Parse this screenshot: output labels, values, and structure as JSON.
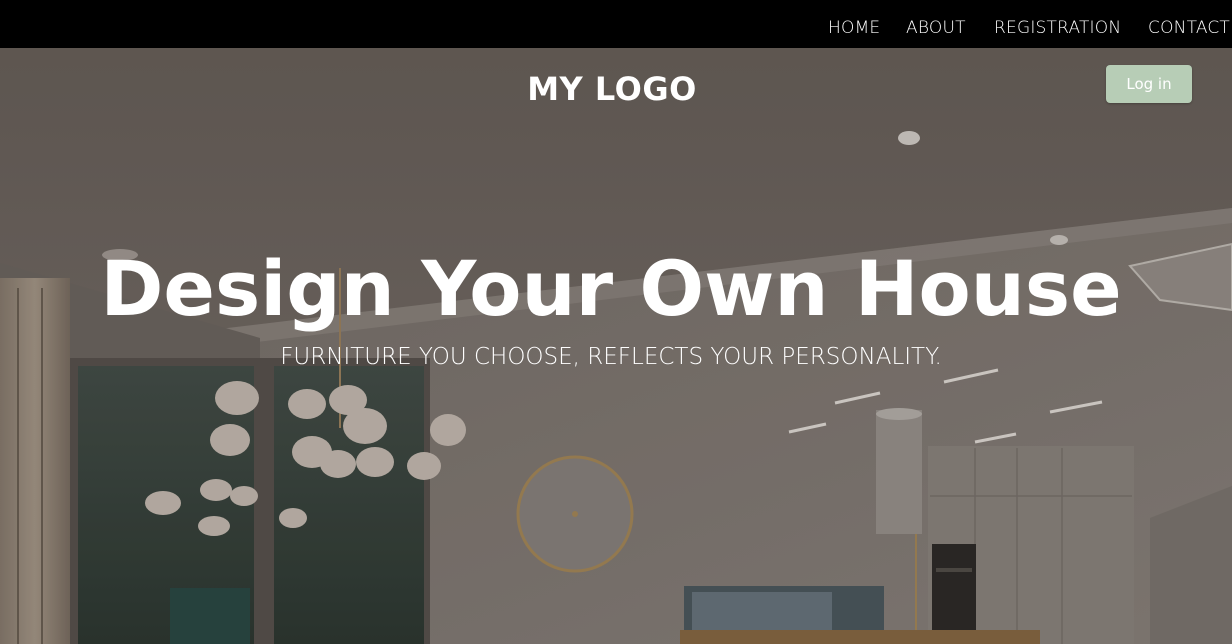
{
  "nav": {
    "items": [
      {
        "label": "HOME"
      },
      {
        "label": "ABOUT"
      },
      {
        "label": "REGISTRATION"
      },
      {
        "label": "CONTACT"
      }
    ]
  },
  "header": {
    "logo_text": "MY LOGO",
    "login_label": "Log in"
  },
  "hero": {
    "title": "Design Your Own House",
    "subtitle": "FURNITURE YOU CHOOSE, REFLECTS YOUR PERSONALITY."
  },
  "colors": {
    "nav_background": "#000000",
    "login_button": "#b7cdb6",
    "text": "#ffffff"
  }
}
